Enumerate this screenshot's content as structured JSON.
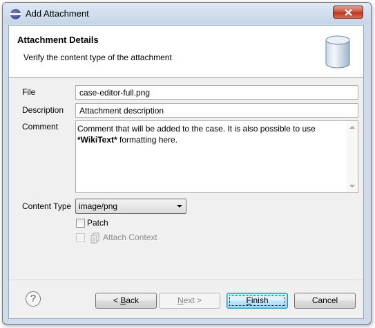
{
  "window": {
    "title": "Add Attachment"
  },
  "header": {
    "title": "Attachment Details",
    "description": "Verify the content type of the attachment"
  },
  "form": {
    "file_label": "File",
    "file_value": "case-editor-full.png",
    "description_label": "Description",
    "description_value": "Attachment description",
    "comment_label": "Comment",
    "comment_text_line1": "Comment that will be added to the case. It is also possible to use",
    "comment_bold": "*WikiText*",
    "comment_text_line2_rest": " formatting here.",
    "content_type_label": "Content Type",
    "content_type_value": "image/png",
    "patch_label": "Patch",
    "patch_checked": false,
    "attach_context_label": "Attach Context",
    "attach_context_enabled": false
  },
  "buttons": {
    "back_prefix": "< ",
    "back_mnemonic": "B",
    "back_rest": "ack",
    "next_mnemonic": "N",
    "next_rest": "ext >",
    "finish_mnemonic": "F",
    "finish_rest": "inish",
    "cancel": "Cancel"
  },
  "icons": {
    "app": "eclipse-icon",
    "close": "close-icon",
    "header": "database-icon",
    "help": "help-icon",
    "context": "context-icon"
  },
  "colors": {
    "close_button": "#c6523e",
    "default_button_border": "#3c7fb1",
    "disabled_text": "#8d8d8d"
  }
}
